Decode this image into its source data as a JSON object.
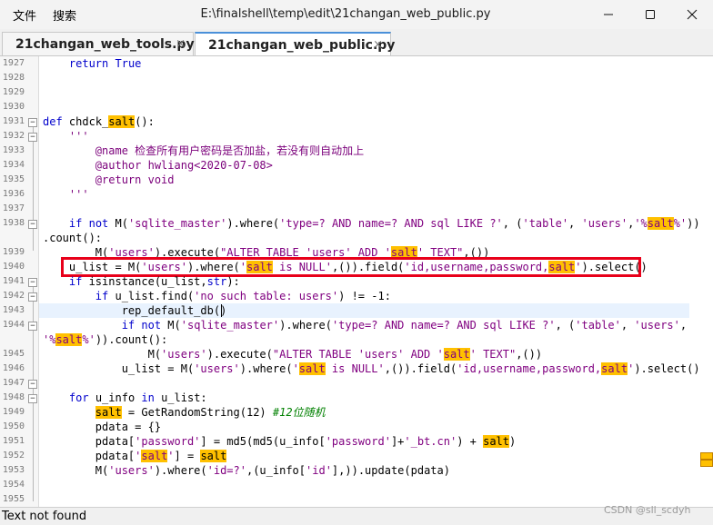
{
  "menu": {
    "file": "文件",
    "search": "搜索"
  },
  "window": {
    "title": "E:\\finalshell\\temp\\edit\\21changan_web_public.py"
  },
  "tabs": [
    {
      "label": "21changan_web_tools.py",
      "close": "×"
    },
    {
      "label": "21changan_web_public.py",
      "close": "×"
    }
  ],
  "gutter_numbers": [
    "1927",
    "1928",
    "1929",
    "1930",
    "1931",
    "1932",
    "1933",
    "1934",
    "1935",
    "1936",
    "1937",
    "1938",
    "",
    "1939",
    "1940",
    "1941",
    "1942",
    "1943",
    "1944",
    "",
    "1945",
    "1946",
    "1947",
    "1948",
    "1949",
    "1950",
    "1951",
    "1952",
    "1953",
    "1954",
    "1955"
  ],
  "code": {
    "l1927_kw": "return",
    "l1927_val": "True",
    "l1931_def": "def",
    "l1931_name": "chdck_",
    "l1931_salt": "salt",
    "l1931_tail": "():",
    "l1932": "'''",
    "l1933": "@name 检查所有用户密码是否加盐，若没有则自动加上",
    "l1934": "@author hwliang<2020-07-08>",
    "l1935": "@return void",
    "l1936": "'''",
    "l1938_a": "if",
    "l1938_b": "not",
    "l1938_c": " M(",
    "l1938_d": "'sqlite_master'",
    "l1938_e": ").where(",
    "l1938_f": "'type=? AND name=? AND sql LIKE ?'",
    "l1938_g": ", (",
    "l1938_h": "'table'",
    "l1938_i": ", ",
    "l1938_j": "'users'",
    "l1938_k": ",",
    "l1938_l": "'%",
    "l1938_m": "salt",
    "l1938_n": "%'",
    "l1938_o": "))",
    "l1938_wrap": ".count():",
    "l1939_a": "M(",
    "l1939_b": "'users'",
    "l1939_c": ").execute(",
    "l1939_d": "\"ALTER TABLE 'users' ADD '",
    "l1939_e": "salt",
    "l1939_f": "' TEXT\"",
    "l1939_g": ",())",
    "l1940_a": "u_list = M(",
    "l1940_b": "'users'",
    "l1940_c": ").where(",
    "l1940_d": "'",
    "l1940_e": "salt",
    "l1940_f": " is NULL'",
    "l1940_g": ",()).field(",
    "l1940_h": "'id,username,password,",
    "l1940_i": "salt",
    "l1940_j": "'",
    "l1940_k": ").select()",
    "l1941_a": "if",
    "l1941_b": " isinstance(u_list,",
    "l1941_c": "str",
    "l1941_d": "):",
    "l1942_a": "if",
    "l1942_b": " u_list.find(",
    "l1942_c": "'no such table: users'",
    "l1942_d": ") != -1:",
    "l1943": "rep_default_db()",
    "l1944_a": "if",
    "l1944_b": "not",
    "l1944_c": " M(",
    "l1944_d": "'sqlite_master'",
    "l1944_e": ").where(",
    "l1944_f": "'type=? AND name=? AND sql LIKE ?'",
    "l1944_g": ", (",
    "l1944_h": "'table'",
    "l1944_i": ", ",
    "l1944_j": "'users'",
    "l1944_k": ",",
    "l1944_wrap_a": "'%",
    "l1944_wrap_b": "salt",
    "l1944_wrap_c": "%'",
    "l1944_wrap_d": ")).count():",
    "l1945_a": "M(",
    "l1945_b": "'users'",
    "l1945_c": ").execute(",
    "l1945_d": "\"ALTER TABLE 'users' ADD '",
    "l1945_e": "salt",
    "l1945_f": "' TEXT\"",
    "l1945_g": ",())",
    "l1946_a": "u_list = M(",
    "l1946_b": "'users'",
    "l1946_c": ").where(",
    "l1946_d": "'",
    "l1946_e": "salt",
    "l1946_f": " is NULL'",
    "l1946_g": ",()).field(",
    "l1946_h": "'id,username,password,",
    "l1946_i": "salt",
    "l1946_j": "'",
    "l1946_k": ").select()",
    "l1948_a": "for",
    "l1948_b": " u_info ",
    "l1948_c": "in",
    "l1948_d": " u_list:",
    "l1949_a": "salt",
    "l1949_b": " = GetRandomString(12) ",
    "l1949_c": "#12位随机",
    "l1950": "pdata = {}",
    "l1951_a": "pdata[",
    "l1951_b": "'password'",
    "l1951_c": "] = md5(md5(u_info[",
    "l1951_d": "'password'",
    "l1951_e": "]+",
    "l1951_f": "'_bt.cn'",
    "l1951_g": ") + ",
    "l1951_h": "salt",
    "l1951_i": ")",
    "l1952_a": "pdata[",
    "l1952_b": "'",
    "l1952_c": "salt",
    "l1952_d": "'",
    "l1952_e": "] = ",
    "l1952_f": "salt",
    "l1953_a": "M(",
    "l1953_b": "'users'",
    "l1953_c": ").where(",
    "l1953_d": "'id=?'",
    "l1953_e": ",(u_info[",
    "l1953_f": "'id'",
    "l1953_g": "],)).update(pdata)"
  },
  "status": {
    "text": "Text not found"
  },
  "watermark": "CSDN @sll_scdyh",
  "colors": {
    "highlight": "#ffc000",
    "keyword": "#0000cc",
    "string": "#800080",
    "comment": "#008000",
    "red_box": "#e8001a",
    "current_line": "#e8f2fe"
  }
}
